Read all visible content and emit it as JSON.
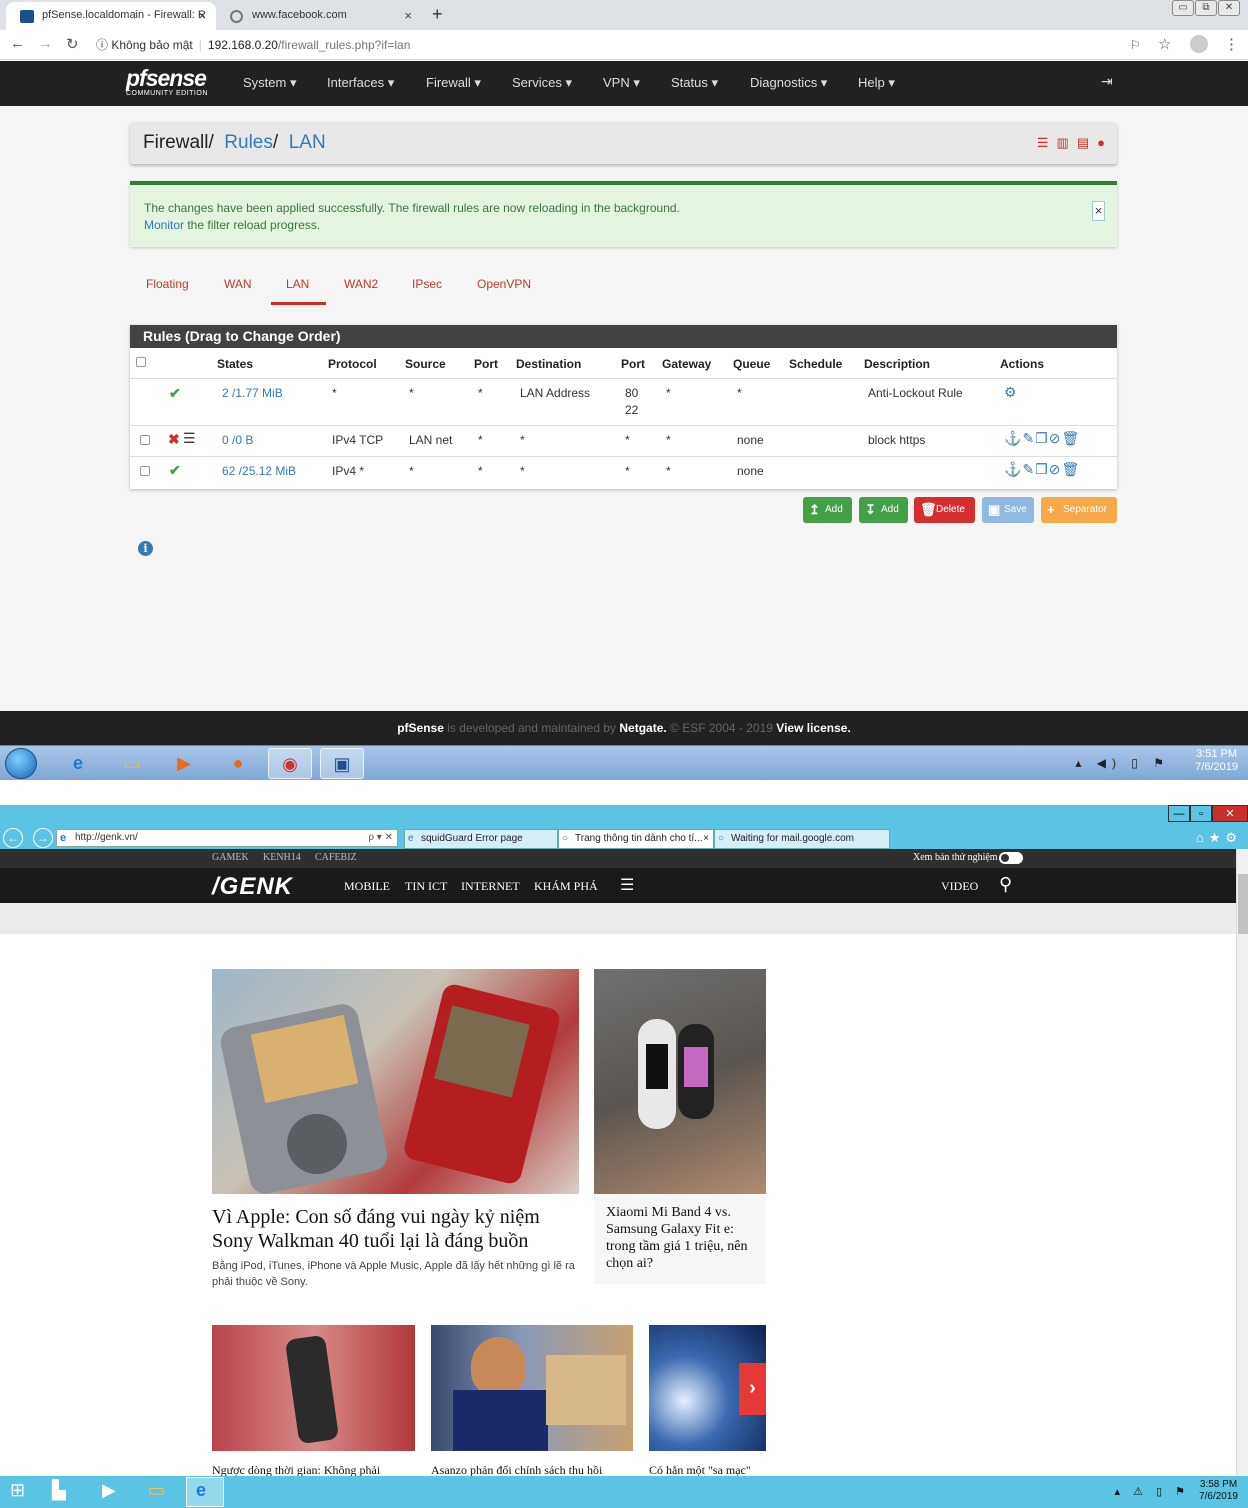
{
  "chrome": {
    "tabs": [
      {
        "title": "pfSense.localdomain - Firewall: R",
        "close": "×"
      },
      {
        "title": "www.facebook.com",
        "close": "×"
      }
    ],
    "new_tab": "+",
    "window_buttons": [
      "▭",
      "⧉",
      "✕"
    ],
    "security": "Không bảo mật",
    "url_host": "192.168.0.20",
    "url_path": "/firewall_rules.php?if=lan"
  },
  "pfsense": {
    "logo_text": "pfsense",
    "logo_sub": "COMMUNITY EDITION",
    "menu": [
      "System ▾",
      "Interfaces ▾",
      "Firewall ▾",
      "Services ▾",
      "VPN ▾",
      "Status ▾",
      "Diagnostics ▾",
      "Help ▾"
    ],
    "breadcrumb": {
      "first": "Firewall",
      "second": "Rules",
      "third": "LAN",
      "sep": "/"
    },
    "alert": {
      "line1": "The changes have been applied successfully. The firewall rules are now reloading in the background.",
      "link": "Monitor",
      "line2": " the filter reload progress.",
      "close": "×"
    },
    "tabs": [
      "Floating",
      "WAN",
      "LAN",
      "WAN2",
      "IPsec",
      "OpenVPN"
    ],
    "active_tab": "LAN",
    "panel_title": "Rules (Drag to Change Order)",
    "columns": [
      "States",
      "Protocol",
      "Source",
      "Port",
      "Destination",
      "Port",
      "Gateway",
      "Queue",
      "Schedule",
      "Description",
      "Actions"
    ],
    "rows": [
      {
        "states": "2 /1.77 MiB",
        "protocol": "*",
        "source": "*",
        "port": "*",
        "destination": "LAN Address",
        "dport": "80",
        "dport2": "22",
        "gateway": "*",
        "queue": "*",
        "schedule": "",
        "description": "Anti-Lockout Rule",
        "status": "pass"
      },
      {
        "states": "0 /0 B",
        "protocol": "IPv4 TCP",
        "source": "LAN net",
        "port": "*",
        "destination": "*",
        "dport": "*",
        "dport2": "",
        "gateway": "*",
        "queue": "none",
        "schedule": "",
        "description": "block https",
        "status": "block"
      },
      {
        "states": "62 /25.12 MiB",
        "protocol": "IPv4 *",
        "source": "*",
        "port": "*",
        "destination": "*",
        "dport": "*",
        "dport2": "",
        "gateway": "*",
        "queue": "none",
        "schedule": "",
        "description": "",
        "status": "pass"
      }
    ],
    "buttons": [
      {
        "label": "Add",
        "icon": "↥",
        "color": "#43a047"
      },
      {
        "label": "Add",
        "icon": "↧",
        "color": "#43a047"
      },
      {
        "label": "Delete",
        "icon": "🗑",
        "color": "#d32f2f"
      },
      {
        "label": "Save",
        "icon": "▣",
        "color": "#90b8e0"
      },
      {
        "label": "Separator",
        "icon": "+",
        "color": "#f5a94a"
      }
    ],
    "footer": {
      "brand": "pfSense",
      "mid": " is developed and maintained by ",
      "company": "Netgate.",
      "copy": " © ESF 2004 - 2019 ",
      "license": "View license."
    }
  },
  "win7_taskbar": {
    "time": "3:51 PM",
    "date": "7/6/2019"
  },
  "ie": {
    "url": "http://genk.vn/",
    "url_controls": "ρ ▾ ✕",
    "tabs": [
      {
        "title": "squidGuard Error page"
      },
      {
        "title": "Trang thông tin dành cho tí...",
        "close": "×"
      },
      {
        "title": "Waiting for mail.google.com"
      }
    ],
    "window_buttons": [
      "—",
      "▫",
      "✕"
    ]
  },
  "genk": {
    "top_links": [
      "GAMEK",
      "KENH14",
      "CAFEBIZ"
    ],
    "toggle_label": "Xem bản thử nghiệm",
    "logo": "/GENK",
    "menu": [
      "MOBILE",
      "TIN ICT",
      "INTERNET",
      "KHÁM PHÁ"
    ],
    "video": "VIDEO",
    "main_title": "Vì Apple: Con số đáng vui ngày kỷ niệm Sony Walkman 40 tuổi lại là đáng buồn",
    "main_sapo": "Bằng iPod, iTunes, iPhone và Apple Music, Apple đã lấy hết những gì lẽ ra phải thuộc về Sony.",
    "side_title": "Xiaomi Mi Band 4 vs. Samsung Galaxy Fit e: trong tầm giá 1 triệu, nên chọn ai?",
    "bottom_titles": [
      "Ngược dòng thời gian: Không phải",
      "Asanzo phản đối chính sách thu hồi",
      "Có hẳn một \"sa mạc\""
    ]
  },
  "win12_taskbar": {
    "time": "3:58 PM",
    "date": "7/6/2019"
  }
}
